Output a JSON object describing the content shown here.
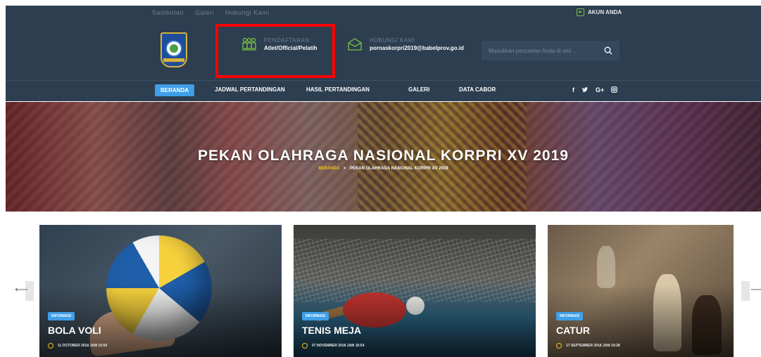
{
  "topbar": {
    "links": [
      "Sambutan",
      "Galeri",
      "Hubungi Kami"
    ],
    "account_label": "AKUN ANDA"
  },
  "header": {
    "registration": {
      "line1": "PENDAFTARAN",
      "line2": "Atlet/Official/Pelatih"
    },
    "contact": {
      "line1": "HUBUNGI KAMI",
      "line2": "pornaskorpri2019@babelprov.go.id"
    },
    "search_placeholder": "Masukkan pencarian Anda di sini ..."
  },
  "nav": {
    "items": [
      "BERANDA",
      "JADWAL PERTANDINGAN",
      "HASIL PERTANDINGAN",
      "GALERI",
      "DATA CABOR"
    ],
    "active_index": 0,
    "social": [
      "f",
      "•",
      "G+",
      "◎"
    ]
  },
  "hero": {
    "title": "PEKAN OLAHRAGA NASIONAL KORPRI XV 2019",
    "breadcrumb_home": "BERANDA",
    "breadcrumb_separator": ">",
    "breadcrumb_current": "PEKAN OLAHRAGA NASIONAL KORPRI XV 2019"
  },
  "cards": [
    {
      "badge": "INFORMASI",
      "title": "BOLA VOLI",
      "date": "11 OCTOBER 2018 JAM 10:50"
    },
    {
      "badge": "INFORMASI",
      "title": "TENIS MEJA",
      "date": "07 NOVEMBER 2018 JAM 16:54"
    },
    {
      "badge": "INFORMASI",
      "title": "CATUR",
      "date": "17 SEPTEMBER 2018 JAM 19:28"
    }
  ],
  "slider": {
    "prev": "⟵",
    "next": "⟶"
  },
  "colors": {
    "header_bg": "#2c3e50",
    "accent_blue": "#3f9fe8",
    "accent_yellow": "#f0c419",
    "icon_green": "#7bc043",
    "highlight_red": "#ff0000"
  }
}
